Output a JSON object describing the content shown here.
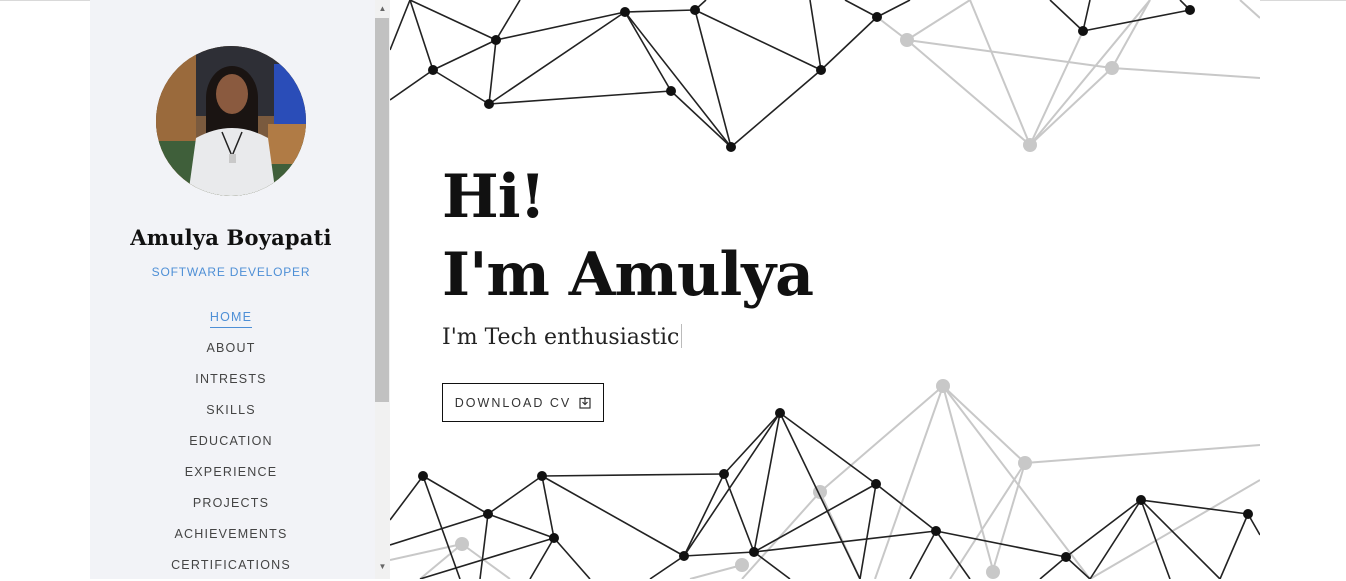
{
  "profile": {
    "name": "Amulya Boyapati",
    "role": "SOFTWARE DEVELOPER",
    "avatar_icon": "profile-photo"
  },
  "nav": {
    "items": [
      {
        "label": "HOME",
        "active": true
      },
      {
        "label": "ABOUT"
      },
      {
        "label": "INTRESTS"
      },
      {
        "label": "SKILLS"
      },
      {
        "label": "EDUCATION"
      },
      {
        "label": "EXPERIENCE"
      },
      {
        "label": "PROJECTS"
      },
      {
        "label": "ACHIEVEMENTS"
      },
      {
        "label": "CERTIFICATIONS"
      }
    ]
  },
  "hero": {
    "line1": "Hi!",
    "line2": "I'm Amulya",
    "subtitle": "I'm Tech enthusiastic",
    "cta_label": "DOWNLOAD CV",
    "cta_icon": "download-file-icon"
  },
  "colors": {
    "accent": "#4e8fd6",
    "sidebar_bg": "#f2f3f7",
    "network_dark": "#111111",
    "network_light": "#c8c8c8"
  }
}
